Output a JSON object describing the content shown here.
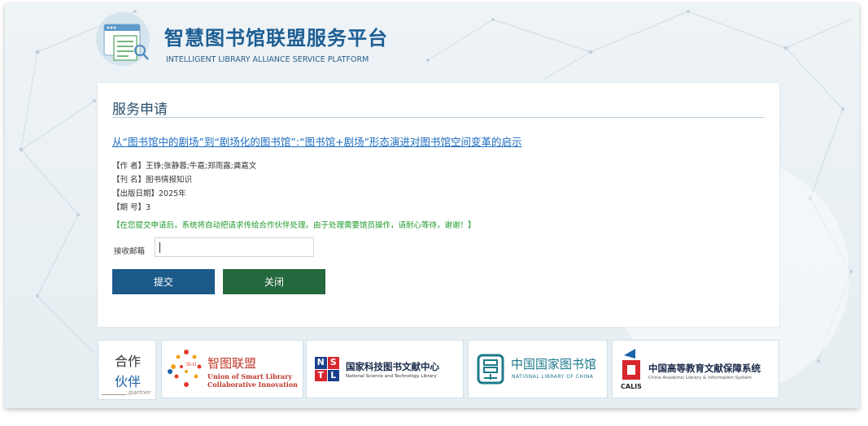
{
  "header": {
    "title": "智慧图书馆联盟服务平台",
    "subtitle": "INTELLIGENT LIBRARY ALLIANCE SERVICE PLATFORM"
  },
  "form": {
    "heading": "服务申请",
    "article_title": "从“图书馆中的剧场”到“剧场化的图书馆”:“图书馆+剧场”形态演进对图书馆空间变革的启示",
    "meta": [
      "【作 者】王铮;张静蓉;牛嘉;郑雨露;龚嘉文",
      "【刊 名】图书情报知识",
      "【出版日期】2025年",
      "【期 号】3"
    ],
    "notice": "【在您提交申请后，系统将自动把请求传给合作伙伴处理。由于处理需要馆员操作，请耐心等待，谢谢！】",
    "email_label": "接收邮箱",
    "email_value": "",
    "submit_label": "提交",
    "close_label": "关闭"
  },
  "partners": {
    "label_line1": "合作",
    "label_line2": "伙伴",
    "label_line3": "/partner",
    "items": [
      {
        "name": "智图联盟",
        "badge": "SI-U",
        "sub1": "Union of Smart Library",
        "sub2": "Collaborative Innovation"
      },
      {
        "name": "国家科技图书文献中心",
        "sub": "National Science and Technology Library",
        "mark": [
          "N",
          "S",
          "T",
          "L"
        ]
      },
      {
        "name": "中国国家图书馆",
        "sub": "NATIONAL LIBRARY OF CHINA"
      },
      {
        "name": "中国高等教育文献保障系统",
        "sub": "China Academic Library & Information System",
        "mark": "CALIS"
      }
    ]
  },
  "colors": {
    "title_blue": "#1d5e94",
    "link_blue": "#1c6dbf",
    "notice_green": "#1f9a2c",
    "submit_bg": "#1c5a8a",
    "close_bg": "#24683e"
  }
}
